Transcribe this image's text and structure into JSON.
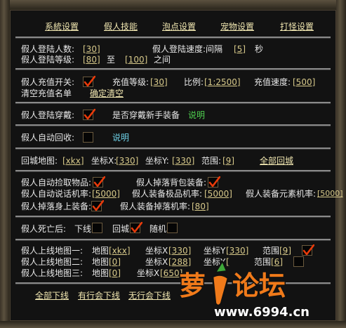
{
  "tabs": [
    "系統设置",
    "假人技能",
    "泡点设置",
    "宠物设置",
    "打怪设置"
  ],
  "login": {
    "count_label": "假人登陆人数:",
    "count": "[30]",
    "speed_label": "假人登陆速度:间隔",
    "speed": "[5]",
    "speed_unit": "秒",
    "level_label": "假人登陆等级:",
    "level_min": "[80]",
    "to": "至",
    "level_max": "[100]",
    "between": "之间"
  },
  "recharge": {
    "switch_label": "假人充值开关:",
    "switch_checked": true,
    "level_label": "充值等级:",
    "level": "[30]",
    "ratio_label": "比例:",
    "ratio": "[1:2500]",
    "speed_label": "充值速度:",
    "speed": "[500]",
    "clear_label": "清空充值名单",
    "clear_link": "确定清空"
  },
  "equip": {
    "wear_label": "假人登陆穿戴:",
    "wear_checked": true,
    "newbie_label": "是否穿戴新手装备",
    "explain": "说明"
  },
  "recycle": {
    "label": "假人自动回收:",
    "checked": false,
    "explain": "说明"
  },
  "city": {
    "map_label": "回城地图:",
    "map": "[xkx]",
    "x_label": "坐标X:",
    "x": "[330]",
    "y_label": "坐标Y:",
    "y": "[330]",
    "range_label": "范围:",
    "range": "[9]",
    "all_return": "全部回城"
  },
  "drops": {
    "pickup_label": "假人自动捡取物品:",
    "pickup_checked": true,
    "bag_drop_label": "假人掉落背包装备:",
    "bag_drop_checked": true,
    "talk_label": "假人自动说话机率:",
    "talk": "[5000]",
    "top_equip_label": "假人装备极品机率:",
    "top_equip": "[5000]",
    "element_label": "假人装备元素机率:",
    "element": "[5000]",
    "body_drop_label": "假人掉落身上装备:",
    "body_drop_checked": true,
    "equip_drop_label": "假人装备掉落机率:",
    "equip_drop": "[80]"
  },
  "death": {
    "label": "假人死亡后:",
    "offline_label": "下线",
    "offline_checked": false,
    "return_label": "回城",
    "return_checked": true,
    "random_label": "随机",
    "random_checked": false
  },
  "online_maps": [
    {
      "label": "假人上线地图一:",
      "map_label": "地图",
      "map": "[xkx]",
      "x_label": "坐标X",
      "x": "[330]",
      "y_label": "坐标Y",
      "y": "[330]",
      "range_label": "范围",
      "range": "[9]",
      "checked": true
    },
    {
      "label": "假人上线地图二:",
      "map_label": "地图",
      "map": "[0]",
      "x_label": "坐标X",
      "x": "[288]",
      "y_label": "坐标Y",
      "y": "[",
      "range_label": "范围",
      "range": "[6]",
      "checked": false
    },
    {
      "label": "假人上线地图三:",
      "map_label": "地图",
      "map": "[0]",
      "x_label": "坐标X",
      "x": "[650]",
      "y_label": "",
      "y": "",
      "range_label": "",
      "range": "",
      "checked": false
    }
  ],
  "footer": {
    "all_offline": "全部下线",
    "guild_offline": "有行会下线",
    "no_guild_offline": "无行会下线"
  },
  "watermark": {
    "text": "萝卜论坛",
    "url": "www.6994.cn"
  },
  "colors": {
    "check": "#e83a0a",
    "link": "#f0e6b0",
    "value": "#d7c98a",
    "green": "#4fd14f",
    "cyan": "#6fd2e8"
  }
}
